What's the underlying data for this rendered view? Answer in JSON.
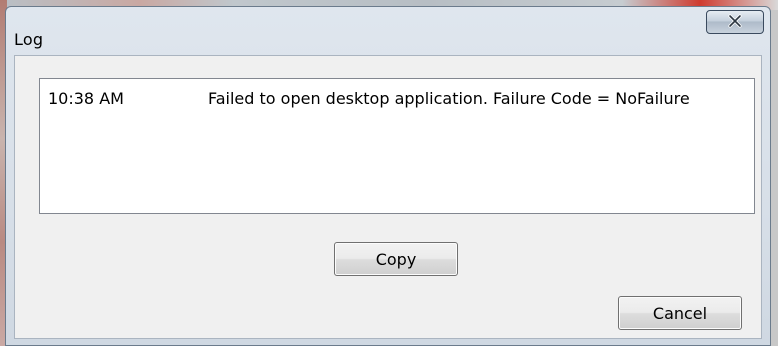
{
  "window": {
    "title": "Log",
    "close_glyph": "x"
  },
  "log": {
    "entries": [
      {
        "time": "10:38 AM",
        "message": "Failed to open desktop application.  Failure Code = NoFailure"
      }
    ]
  },
  "buttons": {
    "copy_label": "Copy",
    "cancel_label": "Cancel"
  },
  "icons": {
    "close": "close-icon"
  },
  "colors": {
    "title_bar": "#d7dfe8",
    "client_bg": "#f0f0f0",
    "list_bg": "#ffffff"
  }
}
